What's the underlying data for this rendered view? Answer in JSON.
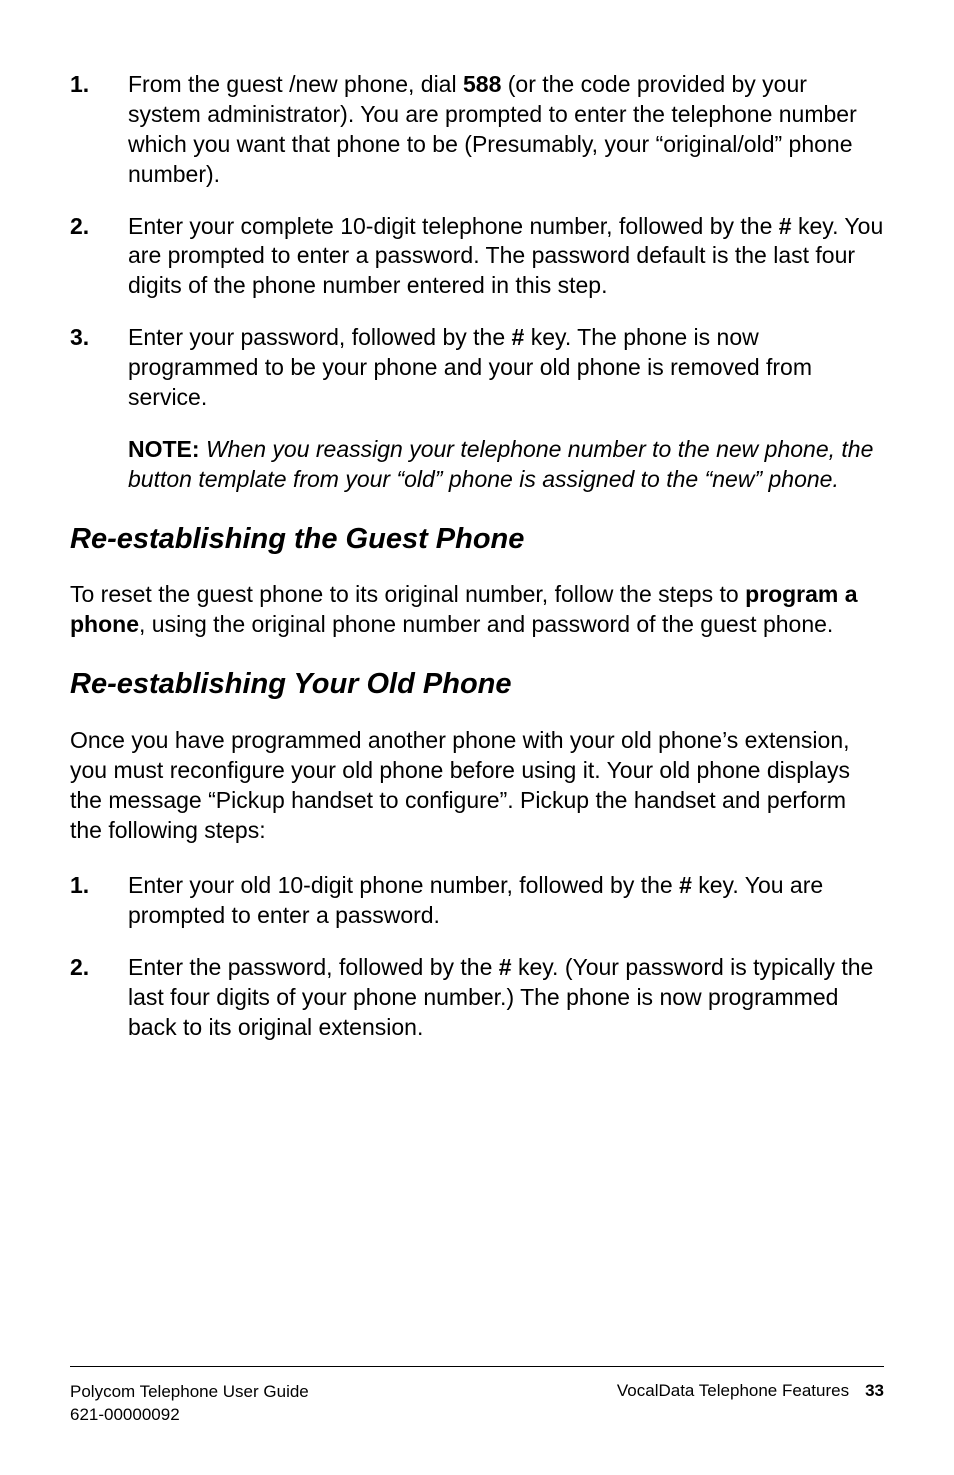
{
  "list1": {
    "items": [
      {
        "num": "1.",
        "prefix": "From the guest /new phone, dial ",
        "bold1": "588",
        "suffix": " (or the code provided by your system administrator). You are prompted to enter the telephone number which you want that phone to be (Presumably, your “original/old” phone number)."
      },
      {
        "num": "2.",
        "prefix": "Enter your complete 10-digit telephone number, followed by the ",
        "bold1": "#",
        "suffix": " key. You are prompted to enter a password. The password default is the last four digits of the phone number entered in this step."
      },
      {
        "num": "3.",
        "prefix": "Enter your password, followed by the ",
        "bold1": "#",
        "suffix": " key. The phone is now programmed to be your phone and your old phone is removed from service."
      }
    ],
    "note": {
      "label": "NOTE:",
      "text": " When you reassign your telephone number to the new phone, the button template from your “old” phone is assigned to the “new” phone."
    }
  },
  "section1": {
    "heading": "Re-establishing the Guest Phone",
    "para_prefix": "To reset the guest phone to its original number, follow the steps to ",
    "para_bold": "program a phone",
    "para_suffix": ", using the original phone number and password of the guest phone."
  },
  "section2": {
    "heading": "Re-establishing Your Old Phone",
    "para": "Once you have programmed another phone with your old phone’s extension, you must reconfigure your old phone before using it. Your old phone displays the message “Pickup handset to configure”. Pickup the handset and perform the following steps:"
  },
  "list2": {
    "items": [
      {
        "num": "1.",
        "prefix": "Enter your old 10-digit phone number, followed by the ",
        "bold1": "#",
        "suffix": " key. You are prompted to enter a password."
      },
      {
        "num": "2.",
        "prefix": "Enter the password, followed by the ",
        "bold1": "#",
        "suffix": " key. (Your password is typically the last four digits of your phone number.) The phone is now programmed back to its original extension."
      }
    ]
  },
  "footer": {
    "left_line1": "Polycom Telephone User Guide",
    "left_line2": "621-00000092",
    "right_text": "VocalData Telephone Features",
    "page": "33"
  }
}
